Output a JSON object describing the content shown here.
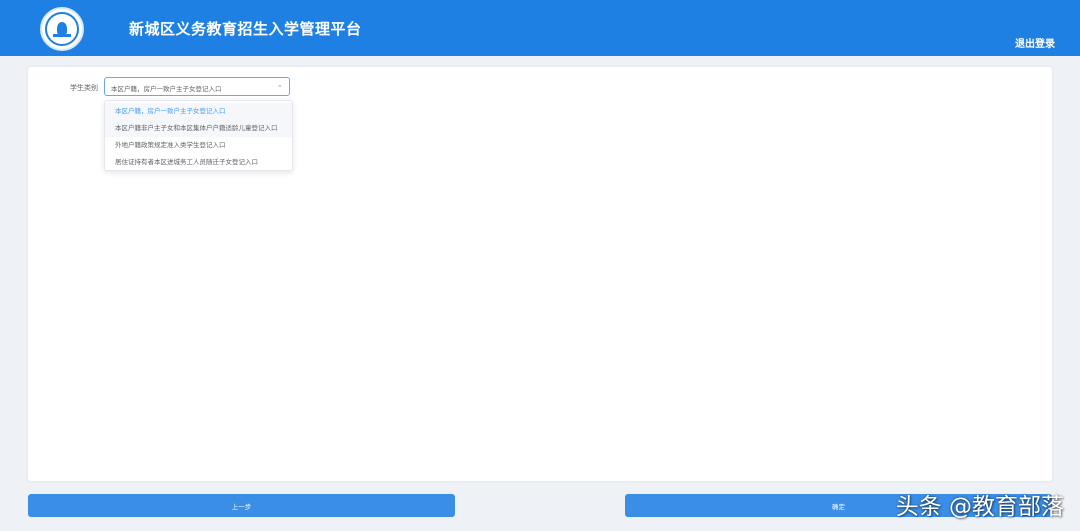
{
  "header": {
    "title": "新城区义务教育招生入学管理平台",
    "logout_label": "退出登录",
    "logo_icon": "school-emblem-icon"
  },
  "form": {
    "student_type_label": "学生类别",
    "selected_value": "本区户籍，房户一致户主子女登记入口",
    "chevron_icon": "chevron-up-icon",
    "options": [
      "本区户籍，房户一致户主子女登记入口",
      "本区户籍非户主子女和本区集体户户籍适龄儿童登记入口",
      "外地户籍政策规定准入类学生登记入口",
      "居住证持有者本区进城务工人员随迁子女登记入口"
    ]
  },
  "buttons": {
    "prev_label": "上一步",
    "confirm_label": "确定"
  },
  "watermark": {
    "text": "头条 @教育部落"
  },
  "colors": {
    "header_bg": "#1e80e2",
    "button_bg": "#3a8ee6",
    "selected_option": "#409eff"
  }
}
